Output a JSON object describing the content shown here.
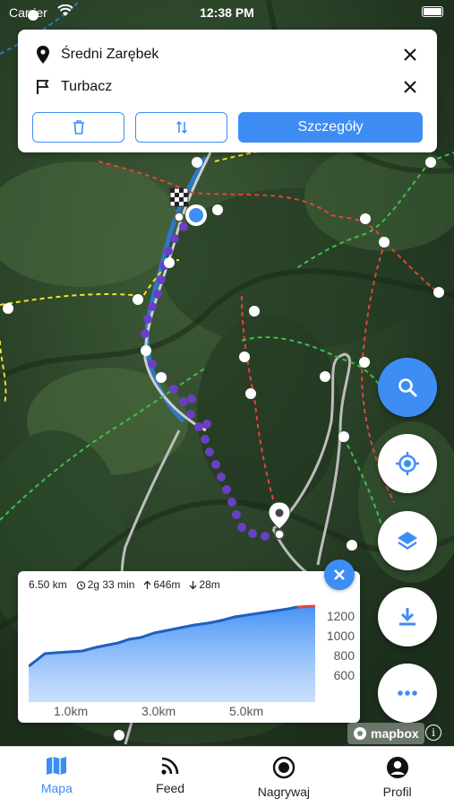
{
  "status_bar": {
    "carrier": "Carrier",
    "time": "12:38 PM"
  },
  "route": {
    "from": "Średni Zarębek",
    "to": "Turbacz",
    "details_label": "Szczegóły"
  },
  "elevation": {
    "distance": "6.50 km",
    "duration": "2g 33 min",
    "ascent": "646m",
    "descent": "28m",
    "y_ticks": [
      "1200",
      "1000",
      "800",
      "600"
    ],
    "x_ticks": [
      "1.0km",
      "3.0km",
      "5.0km"
    ]
  },
  "map": {
    "attribution": "mapbox"
  },
  "tabs": [
    {
      "label": "Mapa",
      "icon": "map-icon",
      "active": true
    },
    {
      "label": "Feed",
      "icon": "rss-feed-icon",
      "active": false
    },
    {
      "label": "Nagrywaj",
      "icon": "record-icon",
      "active": false
    },
    {
      "label": "Profil",
      "icon": "user-icon",
      "active": false
    }
  ],
  "colors": {
    "accent": "#3d8df5",
    "route": "#6a3fc4",
    "trail_red": "#e0453a",
    "trail_yellow": "#f2e22a",
    "trail_green": "#3fbf4a"
  },
  "fab_icons": [
    "search-icon",
    "locate-icon",
    "layers-icon",
    "download-icon",
    "more-icon"
  ]
}
